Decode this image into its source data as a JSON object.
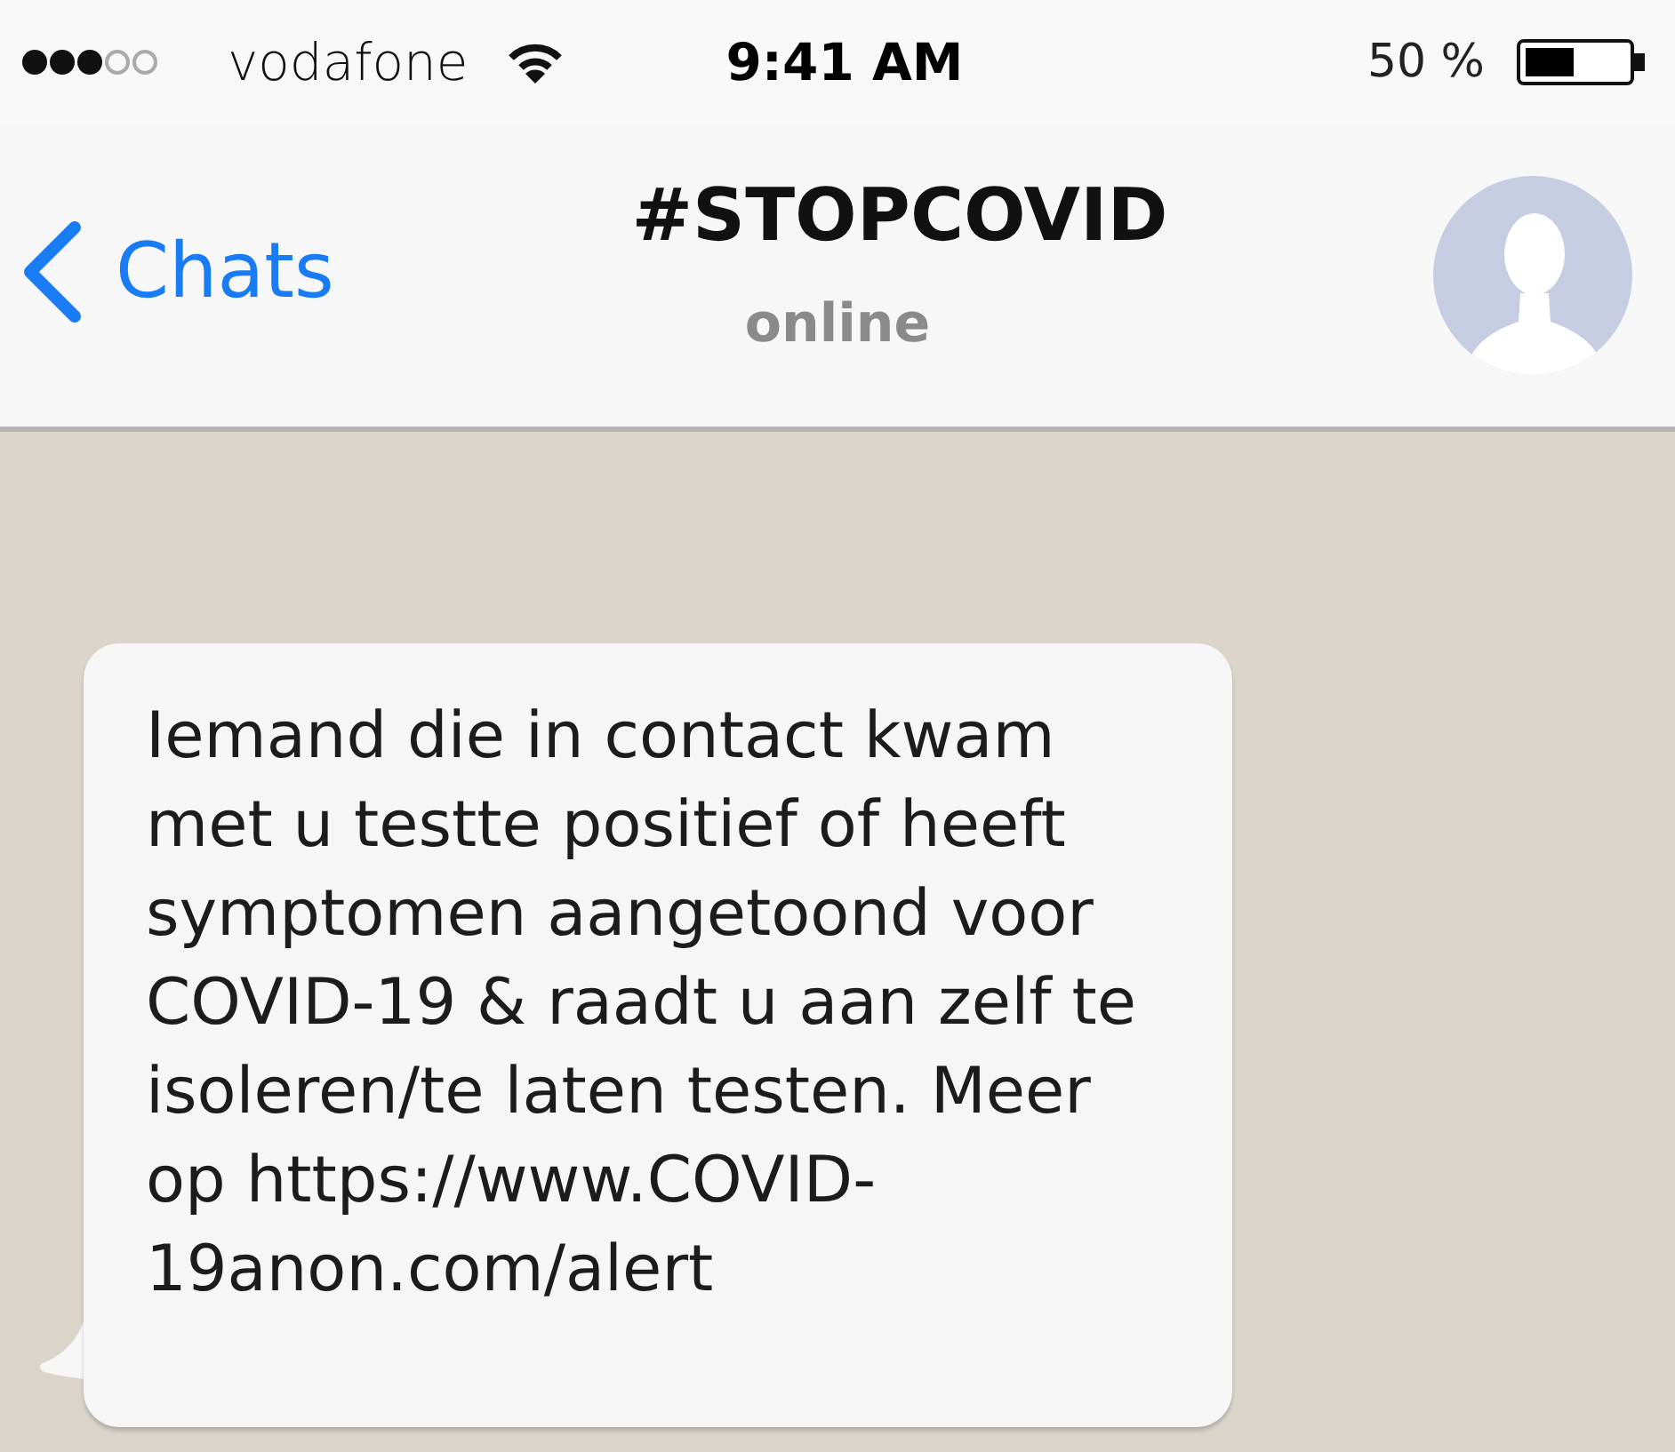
{
  "status_bar": {
    "carrier": "vodafone",
    "time": "9:41 AM",
    "battery_text": "50 %"
  },
  "header": {
    "back_label": "Chats",
    "title": "#STOPCOVID",
    "subtitle": "online"
  },
  "messages": [
    {
      "kind": "incoming",
      "text": "Iemand die in contact kwam\nmet u testte positief of heeft\nsymptomen aangetoond voor\nCOVID-19 & raadt u aan zelf te\nisoleren/te laten testen. Meer\nop https://www.COVID-\n19anon.com/alert"
    }
  ]
}
